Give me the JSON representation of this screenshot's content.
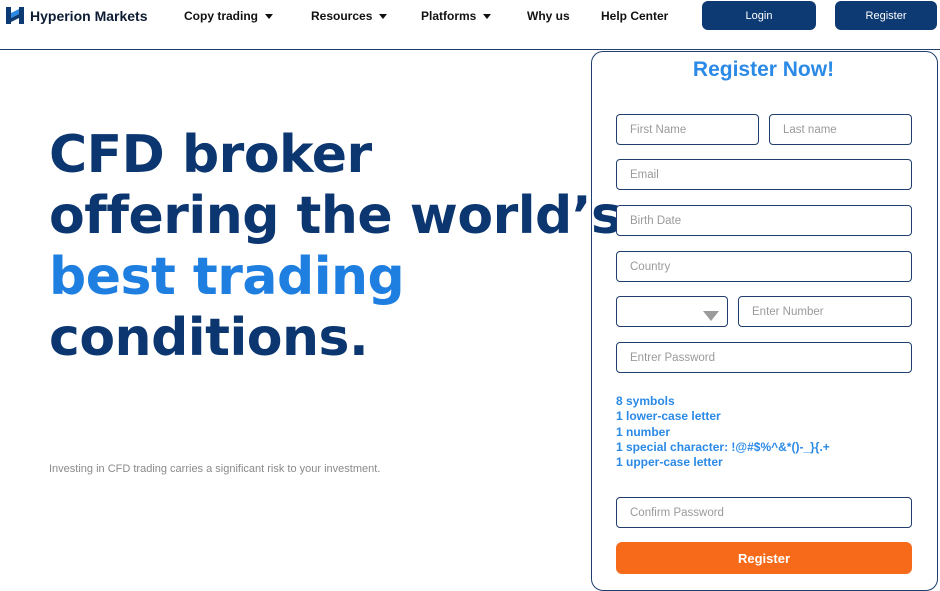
{
  "brand": {
    "name": "Hyperion Markets"
  },
  "nav": {
    "items": [
      {
        "label": "Copy trading",
        "dropdown": true
      },
      {
        "label": "Resources",
        "dropdown": true
      },
      {
        "label": "Platforms",
        "dropdown": true
      },
      {
        "label": "Why us",
        "dropdown": false
      },
      {
        "label": "Help Center",
        "dropdown": false
      }
    ],
    "login_label": "Login",
    "register_label": "Register"
  },
  "hero": {
    "line1": "CFD broker",
    "line2": "offering the world’s",
    "line3": "best trading",
    "line4": "conditions."
  },
  "risk_notice": "Investing in CFD trading carries a significant risk to your investment.",
  "form": {
    "title": "Register Now!",
    "first_name_placeholder": "First Name",
    "last_name_placeholder": "Last name",
    "email_placeholder": "Email",
    "birth_date_placeholder": "Birth Date",
    "country_placeholder": "Country",
    "phone_placeholder": "Enter Number",
    "password_placeholder": "Entrer Password",
    "password_rules": [
      "8 symbols",
      "1 lower-case letter",
      "1 number",
      "1 special character: !@#$%^&*()-_}{.+",
      "1 upper-case letter"
    ],
    "confirm_password_placeholder": "Confirm Password",
    "submit_label": "Register"
  },
  "colors": {
    "navy": "#0b3670",
    "accent_blue": "#1e7fe0",
    "button_navy": "#0d3a72",
    "cta_orange": "#f76a19"
  }
}
